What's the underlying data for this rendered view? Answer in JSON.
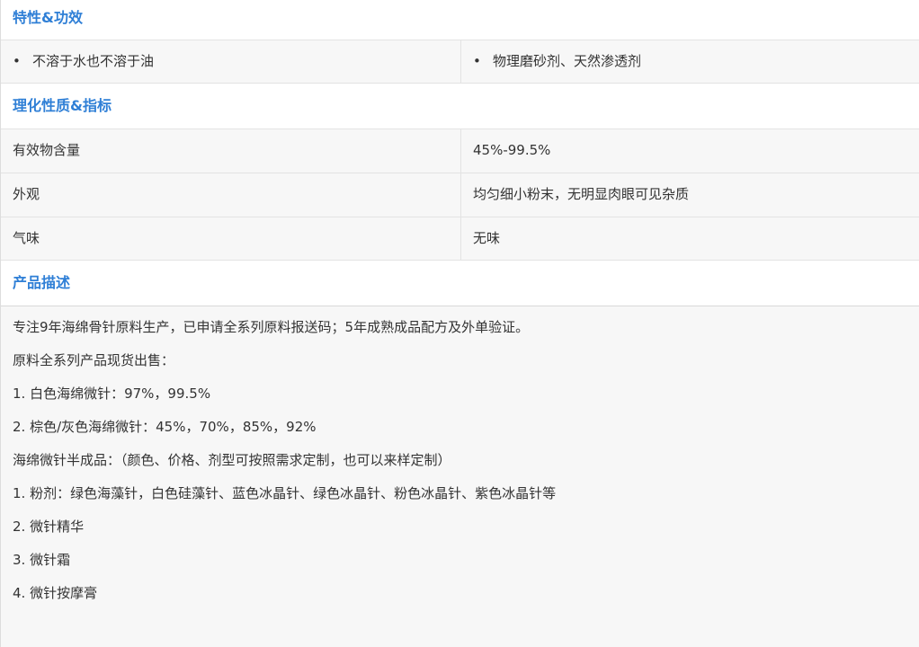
{
  "features": {
    "heading": "特性&功效",
    "items": [
      "不溶于水也不溶于油",
      "物理磨砂剂、天然渗透剂"
    ]
  },
  "properties": {
    "heading": "理化性质&指标",
    "rows": [
      {
        "label": "有效物含量",
        "value": "45%-99.5%"
      },
      {
        "label": "外观",
        "value": "均匀细小粉末，无明显肉眼可见杂质"
      },
      {
        "label": "气味",
        "value": "无味"
      }
    ]
  },
  "description": {
    "heading": "产品描述",
    "lines": [
      "专注9年海绵骨针原料生产，已申请全系列原料报送码；5年成熟成品配方及外单验证。",
      "原料全系列产品现货出售：",
      "1. 白色海绵微针：97%，99.5%",
      "2. 棕色/灰色海绵微针：45%，70%，85%，92%",
      "海绵微针半成品：（颜色、价格、剂型可按照需求定制，也可以来样定制）",
      "1. 粉剂：绿色海藻针，白色硅藻针、蓝色冰晶针、绿色冰晶针、粉色冰晶针、紫色冰晶针等",
      "2. 微针精华",
      "3. 微针霜",
      "4. 微针按摩膏"
    ]
  }
}
